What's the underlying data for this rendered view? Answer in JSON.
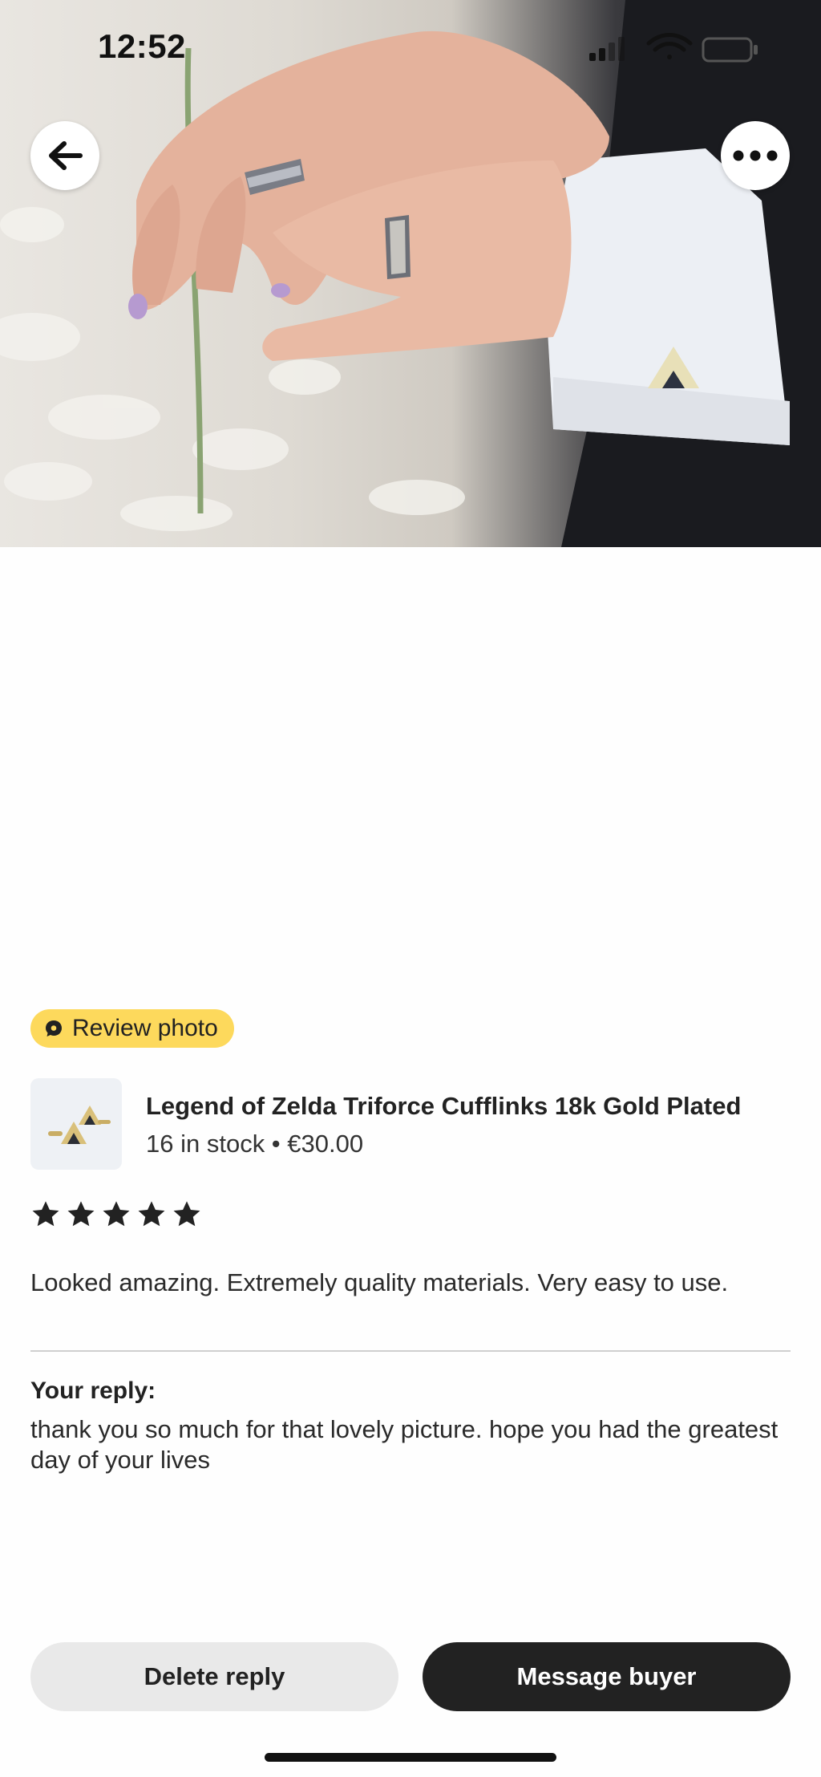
{
  "status_bar": {
    "time": "12:52"
  },
  "hero": {
    "back_icon": "arrow-left-icon",
    "more_icon": "more-horizontal-icon"
  },
  "badge": {
    "label": "Review photo",
    "icon": "review-photo-icon"
  },
  "product": {
    "title": "Legend of Zelda Triforce Cufflinks 18k Gold Plated",
    "meta": "16 in stock • €30.00"
  },
  "review": {
    "rating": 5,
    "max_rating": 5,
    "text": "Looked amazing. Extremely quality materials. Very easy to use."
  },
  "reply": {
    "label": "Your reply:",
    "text": "thank you so much for that lovely picture. hope you had the greatest day of your lives"
  },
  "actions": {
    "delete_label": "Delete reply",
    "message_label": "Message buyer"
  },
  "colors": {
    "badge_bg": "#fdd95c",
    "primary_button": "#222222",
    "secondary_button": "#e9e9e9"
  }
}
